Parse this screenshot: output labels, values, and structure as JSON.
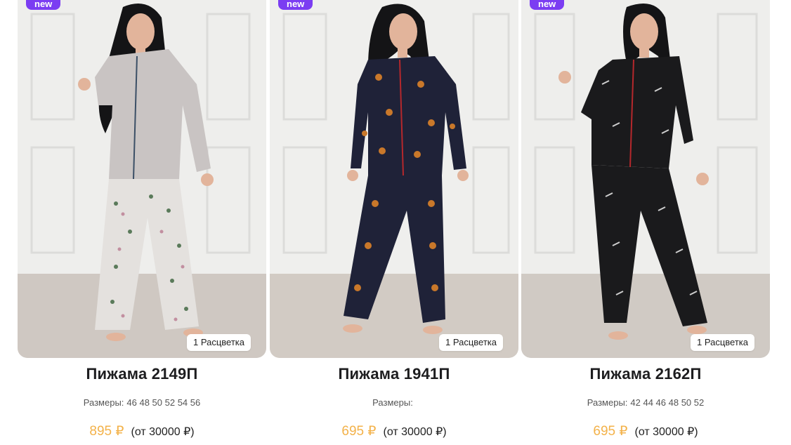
{
  "products": [
    {
      "badge": "new",
      "variants": "1 Расцветка",
      "title": "Пижама 2149П",
      "sizes_label": "Размеры:",
      "sizes": "46 48 50 52 54 56",
      "price": "895 ₽",
      "wholesale": "(от 30000 ₽)",
      "colors": {
        "top": "#c9c4c3",
        "pants": "#e4e1de",
        "accent": "#3b4f66"
      }
    },
    {
      "badge": "new",
      "variants": "1 Расцветка",
      "title": "Пижама 1941П",
      "sizes_label": "Размеры:",
      "sizes": "",
      "price": "695 ₽",
      "wholesale": "(от 30000 ₽)",
      "colors": {
        "top": "#1f2238",
        "pants": "#1f2238",
        "accent": "#c9782a"
      }
    },
    {
      "badge": "new",
      "variants": "1 Расцветка",
      "title": "Пижама 2162П",
      "sizes_label": "Размеры:",
      "sizes": "42 44 46 48 50 52",
      "price": "695 ₽",
      "wholesale": "(от 30000 ₽)",
      "colors": {
        "top": "#1a1a1c",
        "pants": "#1a1a1c",
        "accent": "#b5282c"
      }
    }
  ],
  "theme": {
    "badge": "#7b3df2",
    "price": "#f3b24a"
  }
}
